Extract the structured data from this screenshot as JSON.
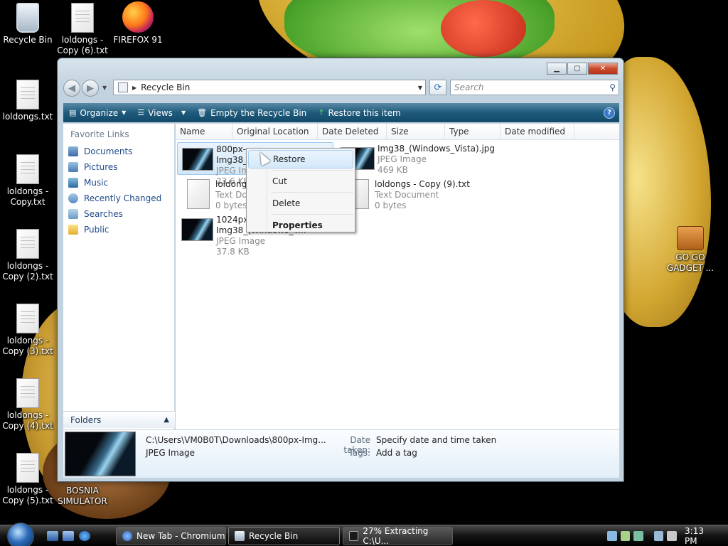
{
  "desktop": {
    "icons": [
      {
        "label": "Recycle Bin"
      },
      {
        "label": "loldongs - Copy (6).txt"
      },
      {
        "label": "FIREFOX 91"
      },
      {
        "label": "loldongs.txt"
      },
      {
        "label": "loldongs - Copy.txt"
      },
      {
        "label": "loldongs - Copy (2).txt"
      },
      {
        "label": "loldongs - Copy (3).txt"
      },
      {
        "label": "loldongs - Copy (4).txt"
      },
      {
        "label": "loldongs - Copy (5).txt"
      },
      {
        "label": "BOSNIA SIMULATOR"
      },
      {
        "label": "GO GO GADGET ..."
      }
    ]
  },
  "window": {
    "address": "Recycle Bin",
    "search_placeholder": "Search",
    "caption": {
      "minimize": "▁",
      "maximize": "▢",
      "close": "✕"
    },
    "toolbar": {
      "organize": "Organize",
      "views": "Views",
      "empty": "Empty the Recycle Bin",
      "restore": "Restore this item",
      "help": "?"
    },
    "nav": {
      "heading": "Favorite Links",
      "items": [
        "Documents",
        "Pictures",
        "Music",
        "Recently Changed",
        "Searches",
        "Public"
      ],
      "folders": "Folders"
    },
    "columns": [
      "Name",
      "Original Location",
      "Date Deleted",
      "Size",
      "Type",
      "Date modified"
    ],
    "files": [
      {
        "name": "800px-Img38_(Windows_Vis...",
        "type": "JPEG Image",
        "size": "23.6 KB"
      },
      {
        "name": "Img38_(Windows_Vista).jpg",
        "type": "JPEG Image",
        "size": "469 KB"
      },
      {
        "name": "loldongs - Copy (8).txt",
        "type": "Text Document",
        "size": "0 bytes"
      },
      {
        "name": "loldongs - Copy (9).txt",
        "type": "Text Document",
        "size": "0 bytes"
      },
      {
        "name": "1024px-Img38_(Windows_V...",
        "type": "JPEG Image",
        "size": "37.8 KB"
      }
    ],
    "context_menu": [
      "Restore",
      "Cut",
      "Delete",
      "Properties"
    ],
    "details": {
      "path": "C:\\Users\\VM0B0T\\Downloads\\800px-Img...",
      "kind": "JPEG Image",
      "date_taken_label": "Date taken:",
      "date_taken_value": "Specify date and time taken",
      "tags_label": "Tags:",
      "tags_value": "Add a tag"
    }
  },
  "taskbar": {
    "tasks": [
      {
        "label": "New Tab - Chromium"
      },
      {
        "label": "Recycle Bin"
      },
      {
        "label": "27% Extracting C:\\U..."
      }
    ],
    "clock": "3:13 PM"
  }
}
